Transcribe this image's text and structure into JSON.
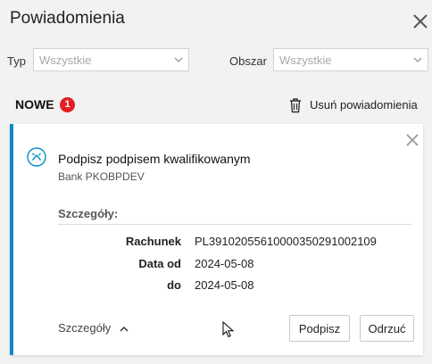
{
  "header": {
    "title": "Powiadomienia"
  },
  "filters": {
    "type_label": "Typ",
    "type_value": "Wszystkie",
    "area_label": "Obszar",
    "area_value": "Wszystkie"
  },
  "section": {
    "label": "NOWE",
    "count": "1",
    "remove_all_label": "Usuń powiadomienia"
  },
  "notification": {
    "title": "Podpisz podpisem kwalifikowanym",
    "source": "Bank PKOBPDEV",
    "details_heading": "Szczegóły:",
    "details": [
      {
        "label": "Rachunek",
        "value": "PL39102055610000350291002109"
      },
      {
        "label": "Data od",
        "value": "2024-05-08"
      },
      {
        "label": "do",
        "value": "2024-05-08"
      }
    ],
    "toggle_label": "Szczegóły",
    "sign_label": "Podpisz",
    "reject_label": "Odrzuć"
  },
  "colors": {
    "accent": "#0a8bc5",
    "badge": "#e31e24"
  }
}
